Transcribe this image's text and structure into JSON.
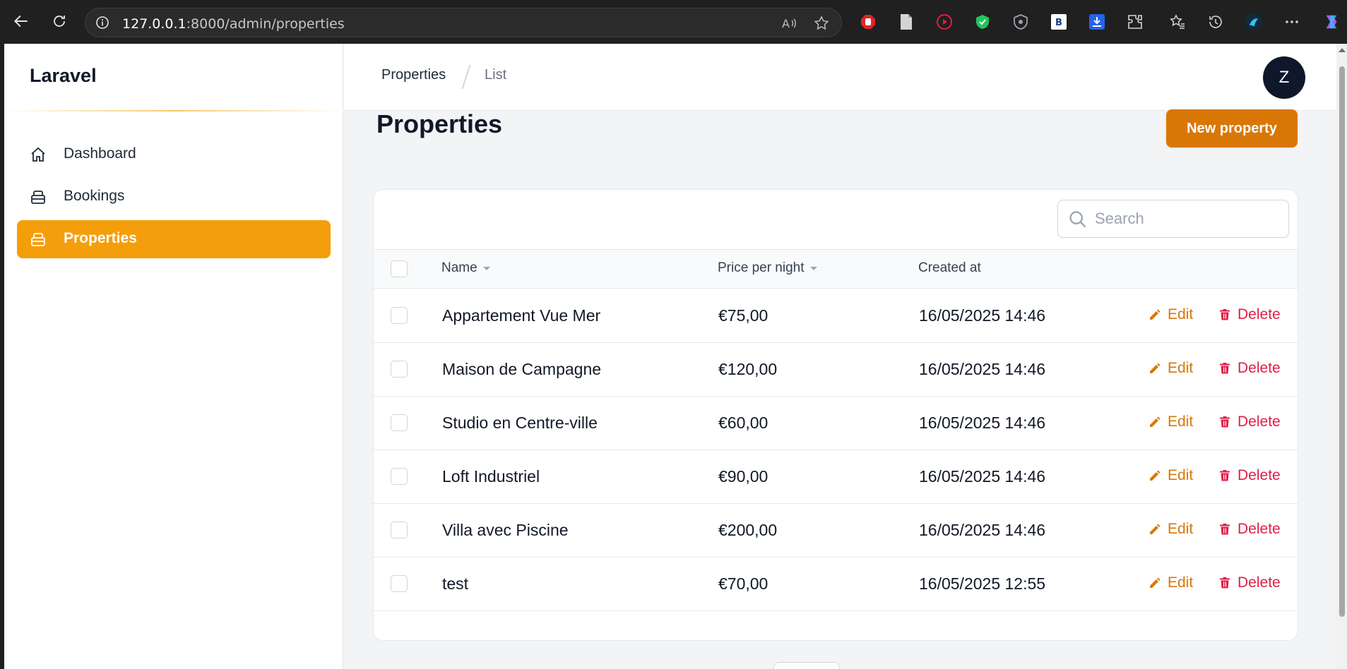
{
  "browser": {
    "url_host": "127.0.0.1",
    "url_rest": ":8000/admin/properties",
    "icons": [
      "back-icon",
      "reload-icon",
      "info-icon",
      "read-aloud-icon",
      "favorite-icon",
      "extension-icons",
      "favorites-icon",
      "history-icon",
      "profile-icon",
      "more-icon",
      "copilot-icon"
    ]
  },
  "sidebar": {
    "brand": "Laravel",
    "items": [
      {
        "label": "Dashboard",
        "icon": "home-icon",
        "active": false
      },
      {
        "label": "Bookings",
        "icon": "building-icon",
        "active": false
      },
      {
        "label": "Properties",
        "icon": "building-icon",
        "active": true
      }
    ]
  },
  "topbar": {
    "breadcrumb": [
      "Properties",
      "List"
    ],
    "avatar_initial": "Z"
  },
  "page": {
    "title": "Properties",
    "new_button": "New property",
    "search_placeholder": "Search"
  },
  "table": {
    "columns": [
      "Name",
      "Price per night",
      "Created at"
    ],
    "edit_label": "Edit",
    "delete_label": "Delete",
    "rows": [
      {
        "name": "Appartement Vue Mer",
        "price": "€75,00",
        "created": "16/05/2025 14:46"
      },
      {
        "name": "Maison de Campagne",
        "price": "€120,00",
        "created": "16/05/2025 14:46"
      },
      {
        "name": "Studio en Centre-ville",
        "price": "€60,00",
        "created": "16/05/2025 14:46"
      },
      {
        "name": "Loft Industriel",
        "price": "€90,00",
        "created": "16/05/2025 14:46"
      },
      {
        "name": "Villa avec Piscine",
        "price": "€200,00",
        "created": "16/05/2025 14:46"
      },
      {
        "name": "test",
        "price": "€70,00",
        "created": "16/05/2025 12:55"
      }
    ]
  },
  "colors": {
    "accent": "#f59e0b",
    "button": "#d97706",
    "danger": "#e11d48"
  }
}
